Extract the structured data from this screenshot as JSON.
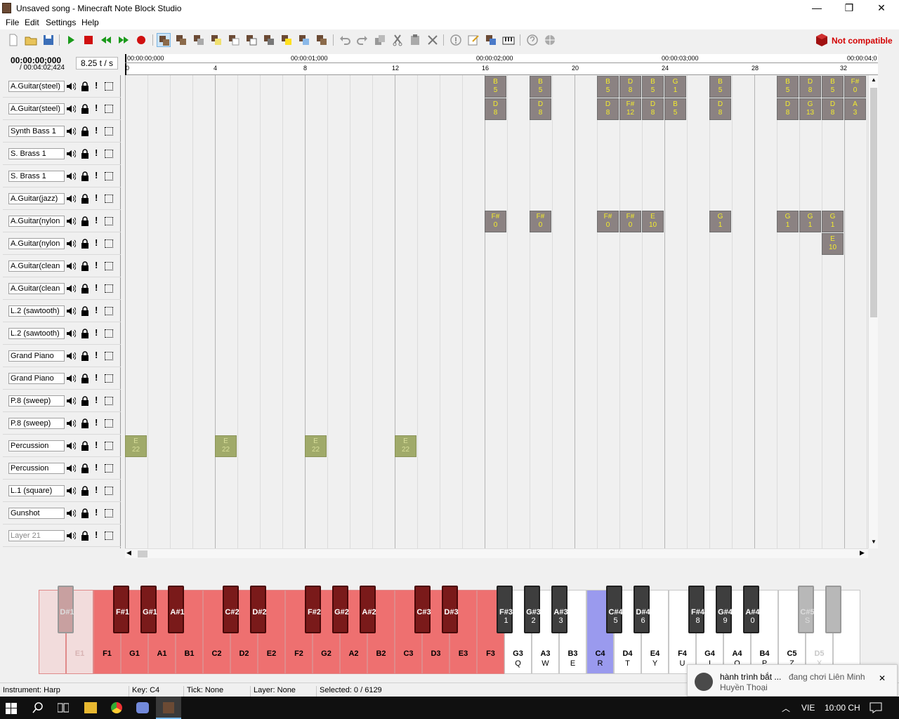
{
  "window": {
    "title": "Unsaved song - Minecraft Note Block Studio",
    "minimize": "—",
    "maximize": "❒",
    "close": "✕"
  },
  "menu": [
    "File",
    "Edit",
    "Settings",
    "Help"
  ],
  "toolbar": {
    "compat_label": "Not compatible"
  },
  "time": {
    "current": "00:00:00;000",
    "total": "/ 00:04:02;424",
    "tempo": "8.25 t / s"
  },
  "ruler": {
    "times": [
      "00:00:00;000",
      "00:00:01;000",
      "00:00:02;000",
      "00:00:03;000",
      "00:00:04;0"
    ],
    "ticks": [
      "0",
      "4",
      "8",
      "12",
      "16",
      "20",
      "24",
      "28",
      "32"
    ]
  },
  "layers": [
    "A.Guitar(steel)",
    "A.Guitar(steel)",
    "Synth Bass 1",
    "S. Brass 1",
    "S. Brass 1",
    "A.Guitar(jazz)",
    "A.Guitar(nylon",
    "A.Guitar(nylon",
    "A.Guitar(clean",
    "A.Guitar(clean",
    "L.2 (sawtooth)",
    "L.2 (sawtooth)",
    "Grand Piano",
    "Grand Piano",
    "P.8 (sweep)",
    "P.8 (sweep)",
    "Percussion",
    "Percussion",
    "L.1 (square)",
    "Gunshot",
    "Layer 21"
  ],
  "layer_controls": {
    "solo": "!"
  },
  "notes": [
    {
      "layer": 0,
      "tick": 16,
      "key": "B",
      "val": "5"
    },
    {
      "layer": 0,
      "tick": 18,
      "key": "B",
      "val": "5"
    },
    {
      "layer": 0,
      "tick": 21,
      "key": "B",
      "val": "5"
    },
    {
      "layer": 0,
      "tick": 22,
      "key": "D",
      "val": "8"
    },
    {
      "layer": 0,
      "tick": 23,
      "key": "B",
      "val": "5"
    },
    {
      "layer": 0,
      "tick": 24,
      "key": "G",
      "val": "1"
    },
    {
      "layer": 0,
      "tick": 26,
      "key": "B",
      "val": "5"
    },
    {
      "layer": 0,
      "tick": 29,
      "key": "B",
      "val": "5"
    },
    {
      "layer": 0,
      "tick": 30,
      "key": "D",
      "val": "8"
    },
    {
      "layer": 0,
      "tick": 31,
      "key": "B",
      "val": "5"
    },
    {
      "layer": 0,
      "tick": 32,
      "key": "F#",
      "val": "0"
    },
    {
      "layer": 1,
      "tick": 16,
      "key": "D",
      "val": "8"
    },
    {
      "layer": 1,
      "tick": 18,
      "key": "D",
      "val": "8"
    },
    {
      "layer": 1,
      "tick": 21,
      "key": "D",
      "val": "8"
    },
    {
      "layer": 1,
      "tick": 22,
      "key": "F#",
      "val": "12"
    },
    {
      "layer": 1,
      "tick": 23,
      "key": "D",
      "val": "8"
    },
    {
      "layer": 1,
      "tick": 24,
      "key": "B",
      "val": "5"
    },
    {
      "layer": 1,
      "tick": 26,
      "key": "D",
      "val": "8"
    },
    {
      "layer": 1,
      "tick": 29,
      "key": "D",
      "val": "8"
    },
    {
      "layer": 1,
      "tick": 30,
      "key": "G",
      "val": "13"
    },
    {
      "layer": 1,
      "tick": 31,
      "key": "D",
      "val": "8"
    },
    {
      "layer": 1,
      "tick": 32,
      "key": "A",
      "val": "3"
    },
    {
      "layer": 6,
      "tick": 16,
      "key": "F#",
      "val": "0"
    },
    {
      "layer": 6,
      "tick": 18,
      "key": "F#",
      "val": "0"
    },
    {
      "layer": 6,
      "tick": 21,
      "key": "F#",
      "val": "0"
    },
    {
      "layer": 6,
      "tick": 22,
      "key": "F#",
      "val": "0"
    },
    {
      "layer": 6,
      "tick": 23,
      "key": "E",
      "val": "10"
    },
    {
      "layer": 6,
      "tick": 26,
      "key": "G",
      "val": "1"
    },
    {
      "layer": 6,
      "tick": 29,
      "key": "G",
      "val": "1"
    },
    {
      "layer": 6,
      "tick": 30,
      "key": "G",
      "val": "1"
    },
    {
      "layer": 6,
      "tick": 31,
      "key": "G",
      "val": "1"
    },
    {
      "layer": 7,
      "tick": 31,
      "key": "E",
      "val": "10"
    },
    {
      "layer": 16,
      "tick": 0,
      "key": "E",
      "val": "22",
      "perc": true
    },
    {
      "layer": 16,
      "tick": 4,
      "key": "E",
      "val": "22",
      "perc": true
    },
    {
      "layer": 16,
      "tick": 8,
      "key": "E",
      "val": "22",
      "perc": true
    },
    {
      "layer": 16,
      "tick": 12,
      "key": "E",
      "val": "22",
      "perc": true
    }
  ],
  "piano": {
    "white_keys": [
      {
        "n": "",
        "k": "",
        "s": "faint"
      },
      {
        "n": "E1",
        "k": "",
        "s": "faint"
      },
      {
        "n": "F1",
        "k": "",
        "s": "red"
      },
      {
        "n": "G1",
        "k": "",
        "s": "red"
      },
      {
        "n": "A1",
        "k": "",
        "s": "red"
      },
      {
        "n": "B1",
        "k": "",
        "s": "red"
      },
      {
        "n": "C2",
        "k": "",
        "s": "red"
      },
      {
        "n": "D2",
        "k": "",
        "s": "red"
      },
      {
        "n": "E2",
        "k": "",
        "s": "red"
      },
      {
        "n": "F2",
        "k": "",
        "s": "red"
      },
      {
        "n": "G2",
        "k": "",
        "s": "red"
      },
      {
        "n": "A2",
        "k": "",
        "s": "red"
      },
      {
        "n": "B2",
        "k": "",
        "s": "red"
      },
      {
        "n": "C3",
        "k": "",
        "s": "red"
      },
      {
        "n": "D3",
        "k": "",
        "s": "red"
      },
      {
        "n": "E3",
        "k": "",
        "s": "red"
      },
      {
        "n": "F3",
        "k": "",
        "s": "red"
      },
      {
        "n": "G3",
        "k": "Q",
        "s": "white"
      },
      {
        "n": "A3",
        "k": "W",
        "s": "white"
      },
      {
        "n": "B3",
        "k": "E",
        "s": "white"
      },
      {
        "n": "C4",
        "k": "R",
        "s": "selected"
      },
      {
        "n": "D4",
        "k": "T",
        "s": "white"
      },
      {
        "n": "E4",
        "k": "Y",
        "s": "white"
      },
      {
        "n": "F4",
        "k": "U",
        "s": "white"
      },
      {
        "n": "G4",
        "k": "I",
        "s": "white"
      },
      {
        "n": "A4",
        "k": "O",
        "s": "white"
      },
      {
        "n": "B4",
        "k": "P",
        "s": "white"
      },
      {
        "n": "C5",
        "k": "Z",
        "s": "white"
      },
      {
        "n": "D5",
        "k": "X",
        "s": "faint-white"
      },
      {
        "n": "",
        "k": "",
        "s": "faint-white"
      }
    ],
    "black_keys": [
      {
        "n": "D#1",
        "k": "",
        "s": "faint"
      },
      {
        "n": "F#1",
        "k": "",
        "s": "red"
      },
      {
        "n": "G#1",
        "k": "",
        "s": "red"
      },
      {
        "n": "A#1",
        "k": "",
        "s": "red"
      },
      {
        "n": "C#2",
        "k": "",
        "s": "red"
      },
      {
        "n": "D#2",
        "k": "",
        "s": "red"
      },
      {
        "n": "F#2",
        "k": "",
        "s": "red"
      },
      {
        "n": "G#2",
        "k": "",
        "s": "red"
      },
      {
        "n": "A#2",
        "k": "",
        "s": "red"
      },
      {
        "n": "C#3",
        "k": "",
        "s": "red"
      },
      {
        "n": "D#3",
        "k": "",
        "s": "red"
      },
      {
        "n": "F#3",
        "k": "1",
        "s": "dark"
      },
      {
        "n": "G#3",
        "k": "2",
        "s": "dark"
      },
      {
        "n": "A#3",
        "k": "3",
        "s": "dark"
      },
      {
        "n": "C#4",
        "k": "5",
        "s": "dark"
      },
      {
        "n": "D#4",
        "k": "6",
        "s": "dark"
      },
      {
        "n": "F#4",
        "k": "8",
        "s": "dark"
      },
      {
        "n": "G#4",
        "k": "9",
        "s": "dark"
      },
      {
        "n": "A#4",
        "k": "0",
        "s": "dark"
      },
      {
        "n": "C#5",
        "k": "S",
        "s": "faint-dark"
      },
      {
        "n": "",
        "k": "",
        "s": "faint-dark"
      }
    ]
  },
  "status": {
    "instrument": "Instrument: Harp",
    "key": "Key: C4",
    "tick": "Tick: None",
    "layer": "Layer: None",
    "selected": "Selected: 0 / 6129"
  },
  "toast": {
    "name": "hành trình bắt ...",
    "line1": "đang chơi Liên Minh",
    "line2": "Huyền Thoại",
    "close": "✕"
  },
  "taskbar": {
    "lang": "VIE",
    "time": "10:00 CH"
  }
}
